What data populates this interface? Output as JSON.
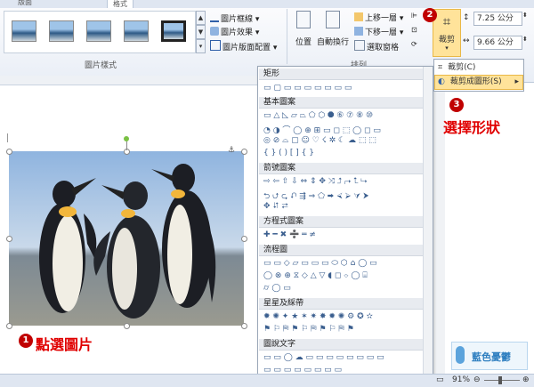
{
  "tabs": [
    "版面",
    "格式"
  ],
  "ribbon": {
    "picture_styles_label": "圖片樣式",
    "arrange_label": "排列",
    "picture_border": "圖片框線",
    "picture_effects": "圖片效果",
    "picture_layout": "圖片版面配置",
    "position": "位置",
    "wrap_text": "自動換行",
    "bring_forward": "上移一層",
    "send_backward": "下移一層",
    "selection_pane": "選取窗格",
    "crop": "裁剪",
    "height_value": "7.25 公分",
    "width_value": "9.66 公分"
  },
  "crop_menu": {
    "crop": "裁剪(C)",
    "crop_to_shape": "裁剪成圖形(S)"
  },
  "shapes_panel": {
    "sections": [
      "矩形",
      "基本圖案",
      "箭號圖案",
      "方程式圖案",
      "流程圖",
      "星星及綵帶",
      "圖說文字"
    ]
  },
  "annotations": {
    "step1_num": "1",
    "step1_text": "點選圖片",
    "step2_num": "2",
    "step3_num": "3",
    "step3_text": "選擇形狀"
  },
  "status": {
    "zoom": "91%"
  },
  "watermark": "藍色憂鬱"
}
